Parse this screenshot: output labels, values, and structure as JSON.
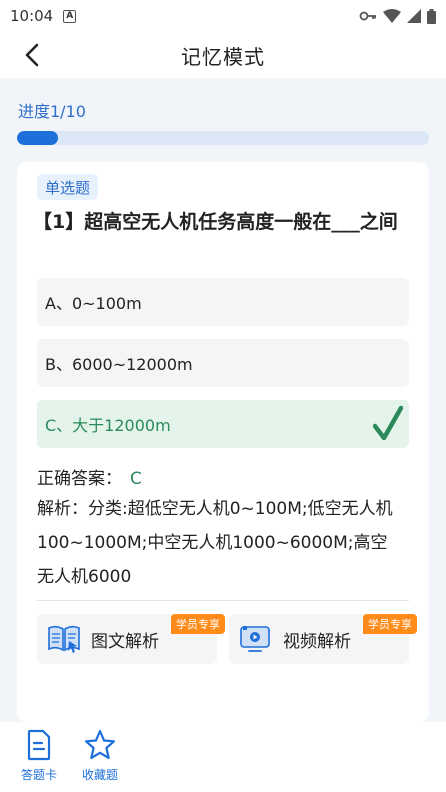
{
  "status": {
    "time": "10:04"
  },
  "header": {
    "title": "记忆模式"
  },
  "progress": {
    "label": "进度1/10",
    "fraction": 0.1
  },
  "question": {
    "type": "单选题",
    "text": "【1】超高空无人机任务高度一般在___之间",
    "options": [
      {
        "label": "A、0~100m",
        "correct": false
      },
      {
        "label": "B、6000~12000m",
        "correct": false
      },
      {
        "label": "C、大于12000m",
        "correct": true
      }
    ],
    "answer_label": "正确答案：",
    "answer_value": "C",
    "analysis": "解析：分类:超低空无人机0~100M;低空无人机100~1000M;中空无人机1000~6000M;高空无人机6000"
  },
  "resources": [
    {
      "label": "图文解析",
      "tag": "学员专享"
    },
    {
      "label": "视频解析",
      "tag": "学员专享"
    }
  ],
  "tabs": [
    {
      "label": "答题卡"
    },
    {
      "label": "收藏题"
    }
  ],
  "colors": {
    "accent": "#1e6fd9",
    "correct": "#2a8a5a",
    "tag": "#ff8c1a"
  }
}
